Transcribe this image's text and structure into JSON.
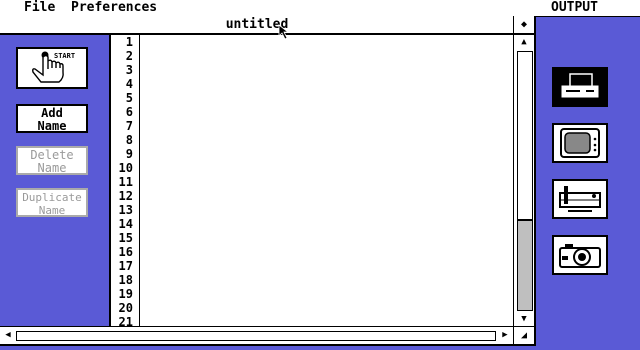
{
  "menu": {
    "file": "File",
    "preferences": "Preferences",
    "output": "OUTPUT"
  },
  "window": {
    "title": "untitled"
  },
  "palette": {
    "start_label": "START",
    "add_name": "Add\nName",
    "delete_name": "Delete\nName",
    "duplicate_name": "Duplicate\nName"
  },
  "line_numbers": [
    "1",
    "2",
    "3",
    "4",
    "5",
    "6",
    "7",
    "8",
    "9",
    "10",
    "11",
    "12",
    "13",
    "14",
    "15",
    "16",
    "17",
    "18",
    "19",
    "20",
    "21"
  ],
  "output": {
    "devices": [
      "printer-icon",
      "monitor-icon",
      "plotter-icon",
      "camera-icon"
    ],
    "selected": "printer-icon"
  },
  "colors": {
    "background": "#5a5ad6",
    "panel": "#ffffff",
    "text": "#000000"
  }
}
